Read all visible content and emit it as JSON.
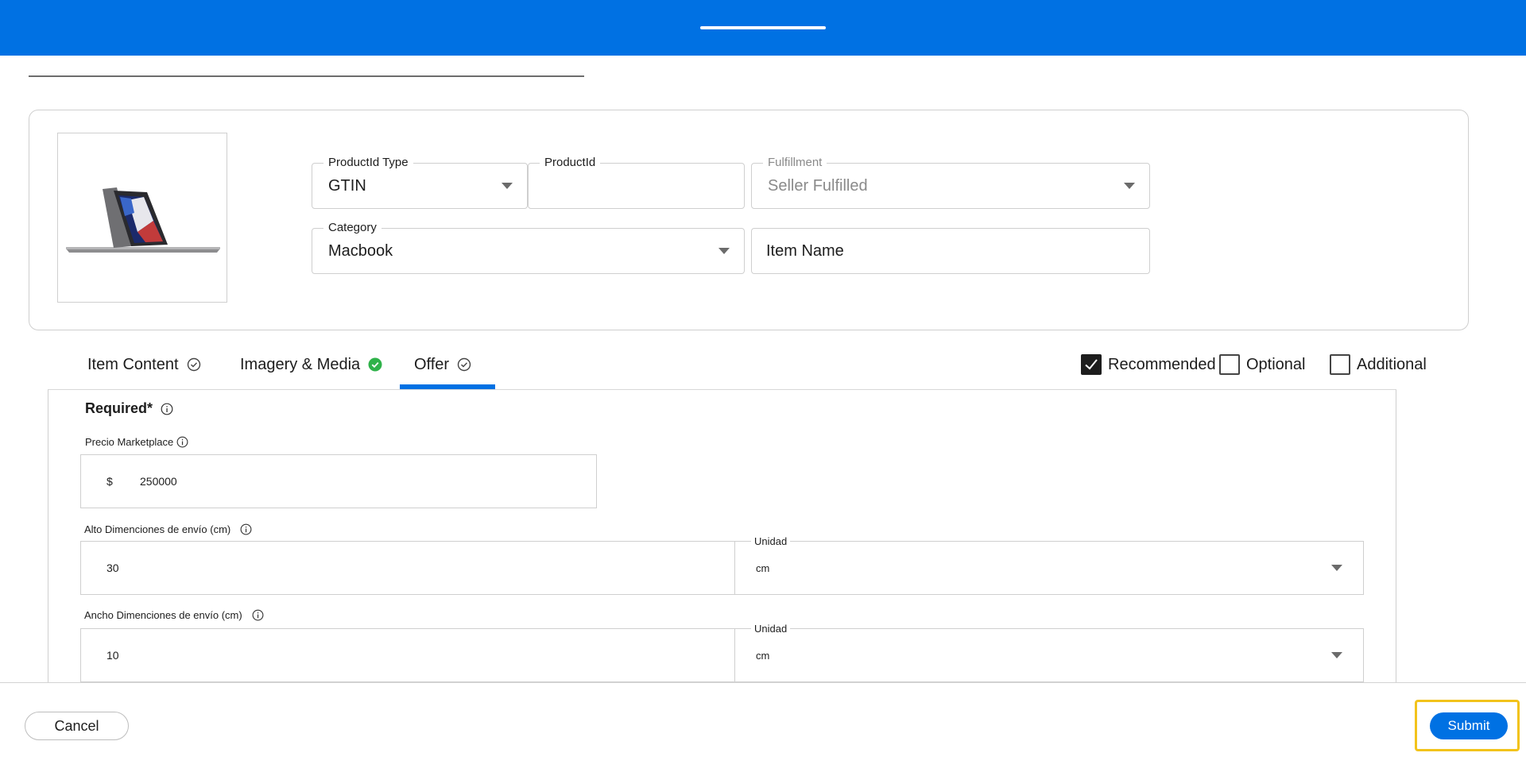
{
  "header": {
    "drag_handle": "drag-handle"
  },
  "product": {
    "productid_type": {
      "label": "ProductId Type",
      "value": "GTIN"
    },
    "productid": {
      "label": "ProductId",
      "value": ""
    },
    "fulfillment": {
      "label": "Fulfillment",
      "value": "Seller Fulfilled"
    },
    "category": {
      "label": "Category",
      "value": "Macbook"
    },
    "item_name": {
      "placeholder": "Item Name"
    }
  },
  "tabs": [
    {
      "label": "Item Content",
      "icon": "check-circle-outline-icon",
      "active": false
    },
    {
      "label": "Imagery & Media",
      "icon": "check-circle-filled-icon",
      "active": false
    },
    {
      "label": "Offer",
      "icon": "check-circle-outline-icon",
      "active": true
    }
  ],
  "filters": [
    {
      "label": "Recommended",
      "checked": true
    },
    {
      "label": "Optional",
      "checked": false
    },
    {
      "label": "Additional",
      "checked": false
    }
  ],
  "offer": {
    "required_title": "Required*",
    "price": {
      "label": "Precio Marketplace",
      "currency": "$",
      "value": "250000"
    },
    "height": {
      "label": "Alto Dimenciones de envío (cm)",
      "value": "30",
      "unit_label": "Unidad",
      "unit_value": "cm"
    },
    "width": {
      "label": "Ancho Dimenciones de envío (cm)",
      "value": "10",
      "unit_label": "Unidad",
      "unit_value": "cm"
    }
  },
  "footer": {
    "cancel_label": "Cancel",
    "submit_label": "Submit"
  },
  "colors": {
    "brand": "#0071e3",
    "success": "#2fb24a",
    "focus": "#f2c31b"
  }
}
